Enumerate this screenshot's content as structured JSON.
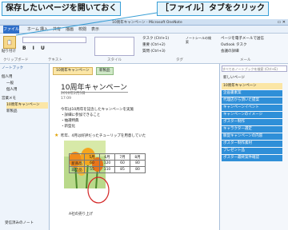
{
  "callouts": {
    "left": "保存したいページを開いておく",
    "right": "［ファイル］タブをクリック"
  },
  "window": {
    "title": "10周年キャンペーン - Microsoft OneNote"
  },
  "ribbon_tabs": [
    "ファイル",
    "ホーム",
    "挿入",
    "共有",
    "描画",
    "校閲",
    "表示"
  ],
  "ribbon": {
    "paste": "貼り付け",
    "group_clipboard": "クリップボード",
    "group_text": "テキスト",
    "group_style": "スタイル",
    "group_tags": "タグ",
    "tags": [
      "タスク (Ctrl+1)",
      "重要 (Ctrl+2)",
      "質問 (Ctrl+3)"
    ],
    "tag_buttons": [
      "ノートシールの検索",
      "タスク"
    ],
    "outlook": [
      "ページを電子メールで送信",
      "Outlook タスク",
      "会議の詳細"
    ],
    "group_outlook": "メール"
  },
  "nav": {
    "header": "ノートブック",
    "items": [
      "個人用",
      "一般",
      "個人用",
      "営業メモ",
      "10周年キャンペーン",
      "新製品"
    ],
    "footer": "受信済みのノート"
  },
  "page_tabs": [
    "10周年キャンペーン",
    "新製品"
  ],
  "search": {
    "placeholder": "すべてのノートブックを検索 (Ctrl+E)"
  },
  "note": {
    "title": "10周年キャンペーン",
    "date": "2010年2月5日",
    "time": "17:09",
    "body": [
      "今年は10周年を記念したキャンペーンを実施",
      "・詳細に参加できること",
      "・抽選特典",
      "・新型化"
    ],
    "flag_text": "昨年、4月は好評だったチューリップを用意していた",
    "table_caption": "A社の売り上げ",
    "table": [
      [
        "",
        "5月",
        "6月",
        "7月",
        "8月"
      ],
      [
        "新商品",
        "60",
        "120",
        "60",
        "80"
      ],
      [
        "非全品",
        "55",
        "110",
        "85",
        "80"
      ]
    ]
  },
  "right_panel": {
    "header": "新しいページ",
    "pages": [
      "10周年キャンペーン",
      "企画書素案",
      "代理店から頂いた提案",
      "キャンペーンイベント",
      "キャンペーンのイメージ",
      "ポスター制作",
      "キャラクター選定",
      "販促キャンペーンの内容",
      "ポスター制作素材",
      "プレゼント品",
      "ポスター最終案件確認"
    ]
  }
}
